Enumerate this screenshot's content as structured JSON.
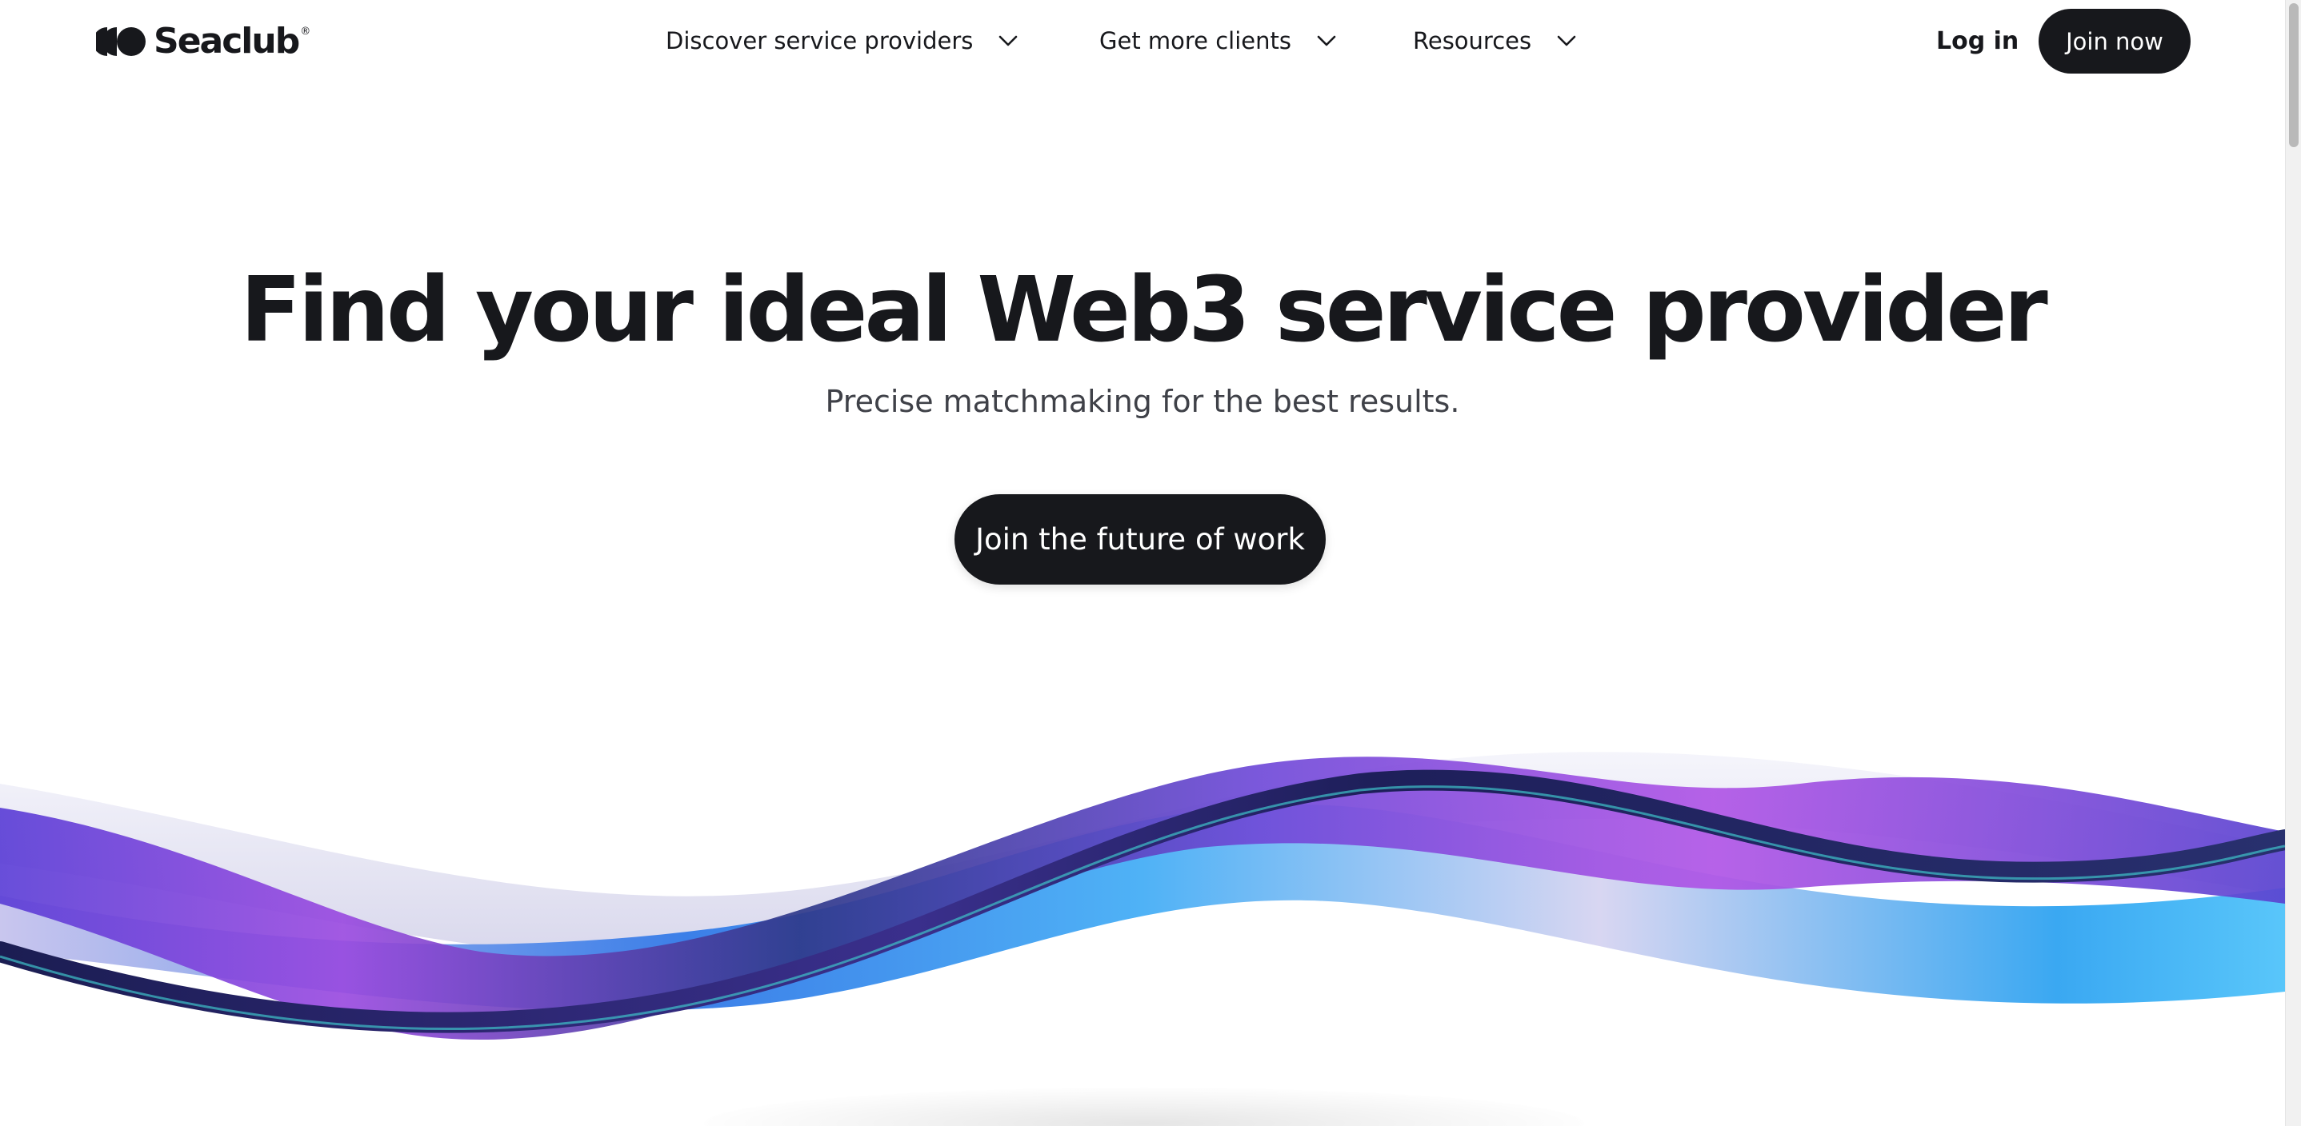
{
  "header": {
    "logo": {
      "name": "Seaclub",
      "registered_mark": "®"
    },
    "nav": [
      {
        "label": "Discover service providers",
        "icon": "chevron-down-icon"
      },
      {
        "label": "Get more clients",
        "icon": "chevron-down-icon"
      },
      {
        "label": "Resources",
        "icon": "chevron-down-icon"
      }
    ],
    "login_label": "Log in",
    "join_label": "Join now"
  },
  "hero": {
    "title": "Find your ideal Web3 service provider",
    "subtitle": "Precise matchmaking for the best results.",
    "cta_label": "Join the future of work"
  },
  "colors": {
    "text": "#17181c",
    "button_bg": "#17181c",
    "button_text": "#ffffff",
    "ribbon_purple": "#8a48e0",
    "ribbon_blue": "#3d8ff0",
    "ribbon_navy": "#1c1d4a"
  }
}
